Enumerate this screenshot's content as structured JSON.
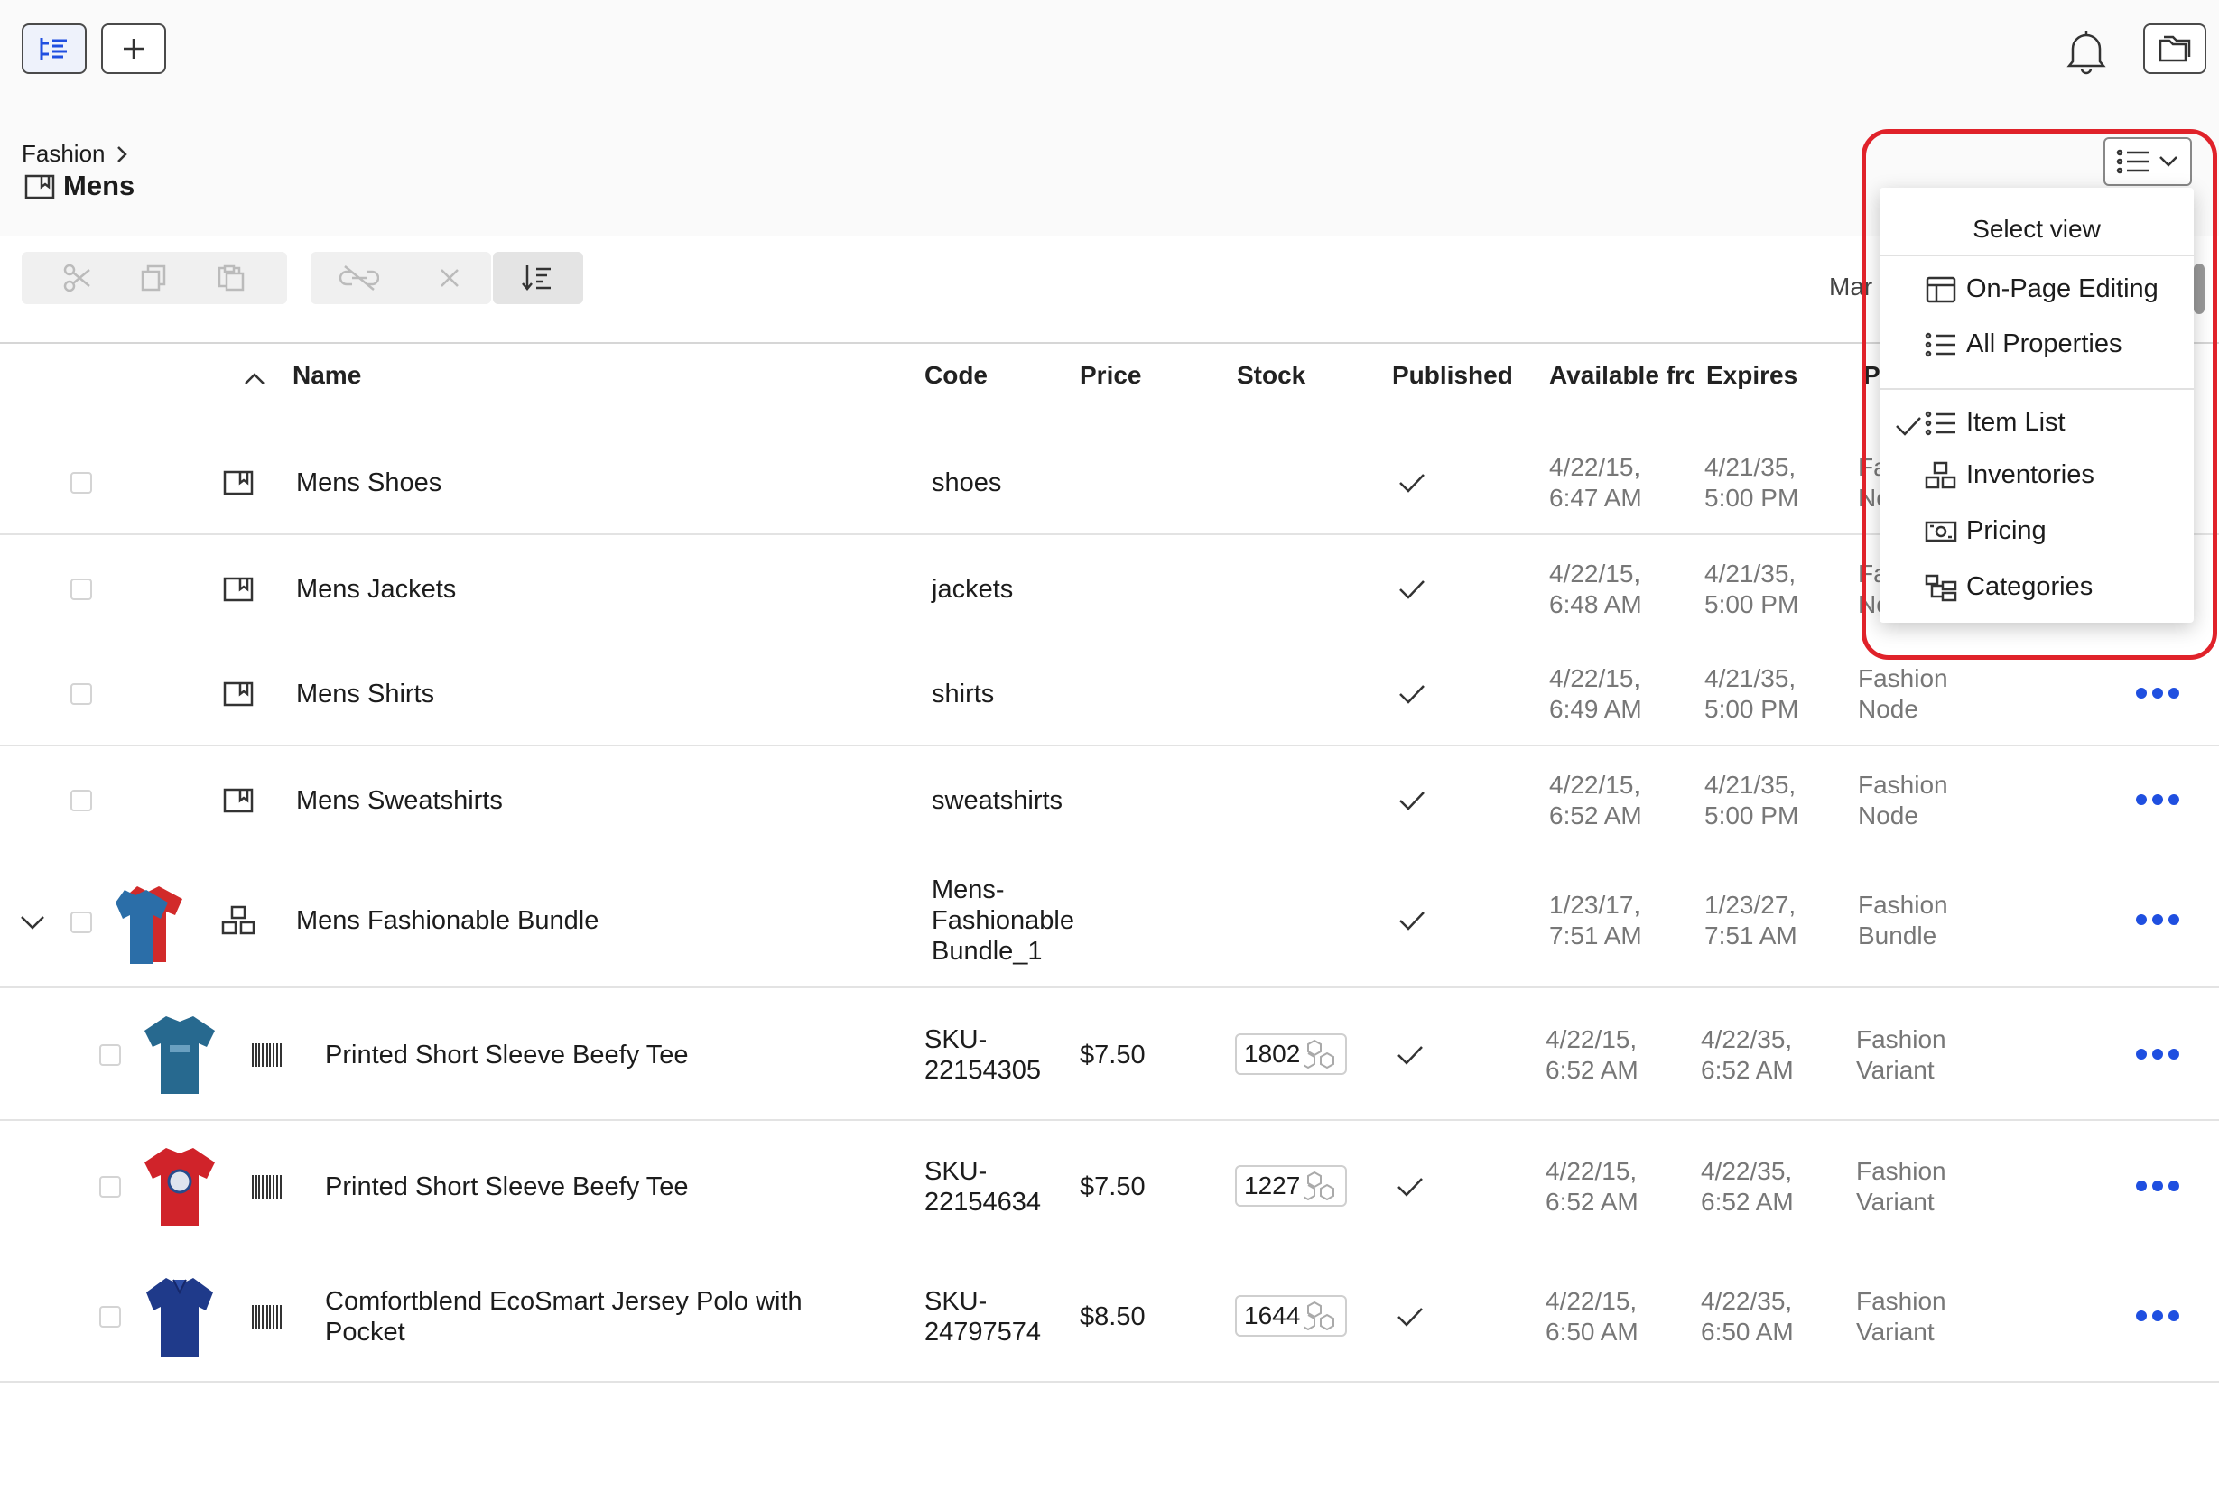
{
  "breadcrumb": {
    "parent": "Fashion",
    "current": "Mens"
  },
  "top_partial_label": "Mar",
  "columns": {
    "name": "Name",
    "code": "Code",
    "price": "Price",
    "stock": "Stock",
    "published": "Published",
    "available": "Available frc",
    "expires": "Expires",
    "type_partial": "P"
  },
  "rows": [
    {
      "name": "Mens Shoes",
      "code": "shoes",
      "price": "",
      "stock": "",
      "available": [
        "4/22/15,",
        "6:47 AM"
      ],
      "expires": [
        "4/21/35,",
        "5:00 PM"
      ],
      "type": [
        "Fa",
        "No"
      ],
      "kind": "folder"
    },
    {
      "name": "Mens Jackets",
      "code": "jackets",
      "price": "",
      "stock": "",
      "available": [
        "4/22/15,",
        "6:48 AM"
      ],
      "expires": [
        "4/21/35,",
        "5:00 PM"
      ],
      "type": [
        "Fa",
        "No"
      ],
      "kind": "folder"
    },
    {
      "name": "Mens Shirts",
      "code": "shirts",
      "price": "",
      "stock": "",
      "available": [
        "4/22/15,",
        "6:49 AM"
      ],
      "expires": [
        "4/21/35,",
        "5:00 PM"
      ],
      "type": [
        "Fashion",
        "Node"
      ],
      "kind": "folder"
    },
    {
      "name": "Mens Sweatshirts",
      "code": "sweatshirts",
      "price": "",
      "stock": "",
      "available": [
        "4/22/15,",
        "6:52 AM"
      ],
      "expires": [
        "4/21/35,",
        "5:00 PM"
      ],
      "type": [
        "Fashion",
        "Node"
      ],
      "kind": "folder"
    },
    {
      "name": "Mens Fashionable Bundle",
      "code": [
        "Mens-",
        "Fashionable",
        "Bundle_1"
      ],
      "price": "",
      "stock": "",
      "available": [
        "1/23/17,",
        "7:51 AM"
      ],
      "expires": [
        "1/23/27,",
        "7:51 AM"
      ],
      "type": [
        "Fashion",
        "Bundle"
      ],
      "kind": "bundle"
    },
    {
      "name": "Printed Short Sleeve Beefy Tee",
      "code": [
        "SKU-",
        "22154305"
      ],
      "price": "$7.50",
      "stock": "1802",
      "available": [
        "4/22/15,",
        "6:52 AM"
      ],
      "expires": [
        "4/22/35,",
        "6:52 AM"
      ],
      "type": [
        "Fashion",
        "Variant"
      ],
      "kind": "variant"
    },
    {
      "name": "Printed Short Sleeve Beefy Tee",
      "code": [
        "SKU-",
        "22154634"
      ],
      "price": "$7.50",
      "stock": "1227",
      "available": [
        "4/22/15,",
        "6:52 AM"
      ],
      "expires": [
        "4/22/35,",
        "6:52 AM"
      ],
      "type": [
        "Fashion",
        "Variant"
      ],
      "kind": "variant"
    },
    {
      "name": [
        "Comfortblend EcoSmart Jersey Polo with",
        "Pocket"
      ],
      "code": [
        "SKU-",
        "24797574"
      ],
      "price": "$8.50",
      "stock": "1644",
      "available": [
        "4/22/15,",
        "6:50 AM"
      ],
      "expires": [
        "4/22/35,",
        "6:50 AM"
      ],
      "type": [
        "Fashion",
        "Variant"
      ],
      "kind": "variant"
    }
  ],
  "view_menu": {
    "title": "Select view",
    "items": [
      "On-Page Editing",
      "All Properties",
      "Item List",
      "Inventories",
      "Pricing",
      "Categories"
    ],
    "selected": "Item List"
  },
  "colors": {
    "accent": "#1f4fe0",
    "highlight": "#e0222a"
  }
}
